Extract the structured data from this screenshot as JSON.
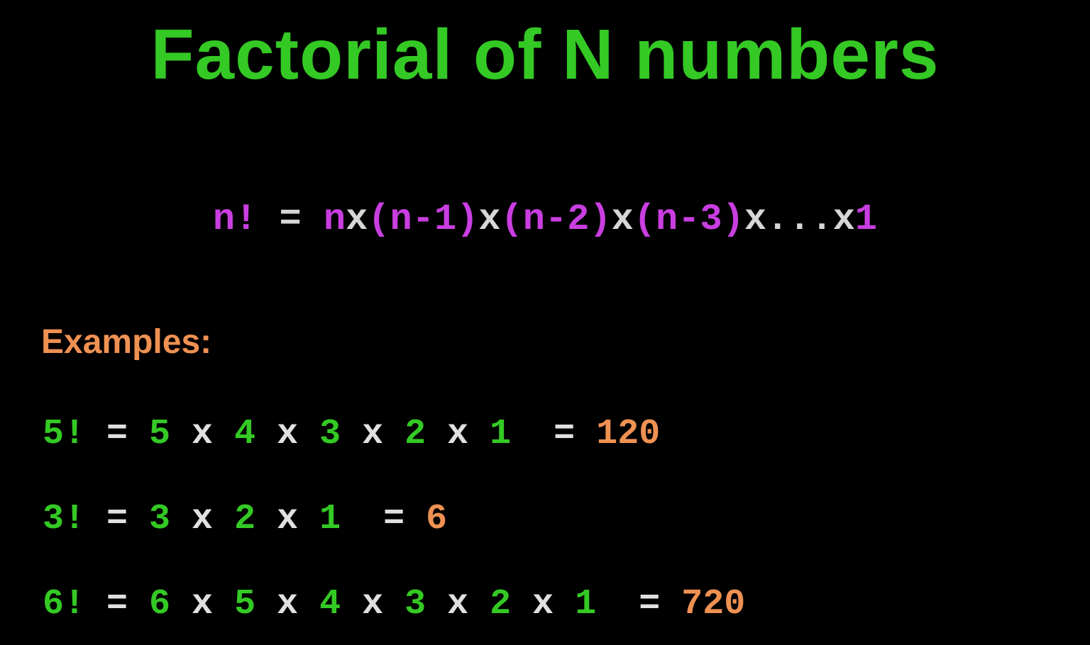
{
  "title": "Factorial of N numbers",
  "formula": {
    "tokens": [
      {
        "t": "n!",
        "c": "purple"
      },
      {
        "t": " = ",
        "c": "white"
      },
      {
        "t": "n",
        "c": "purple"
      },
      {
        "t": "x",
        "c": "white"
      },
      {
        "t": "(n-1)",
        "c": "purple"
      },
      {
        "t": "x",
        "c": "white"
      },
      {
        "t": "(n-2)",
        "c": "purple"
      },
      {
        "t": "x",
        "c": "white"
      },
      {
        "t": "(n-3)",
        "c": "purple"
      },
      {
        "t": "x...x",
        "c": "white"
      },
      {
        "t": "1",
        "c": "purple"
      }
    ]
  },
  "examples_label": "Examples:",
  "examples": [
    {
      "tokens": [
        {
          "t": "5!",
          "c": "green"
        },
        {
          "t": " = ",
          "c": "white"
        },
        {
          "t": "5",
          "c": "green"
        },
        {
          "t": " x ",
          "c": "white"
        },
        {
          "t": "4",
          "c": "green"
        },
        {
          "t": " x ",
          "c": "white"
        },
        {
          "t": "3",
          "c": "green"
        },
        {
          "t": " x ",
          "c": "white"
        },
        {
          "t": "2",
          "c": "green"
        },
        {
          "t": " x ",
          "c": "white"
        },
        {
          "t": "1",
          "c": "green"
        },
        {
          "t": "  = ",
          "c": "white"
        },
        {
          "t": "120",
          "c": "orange"
        }
      ]
    },
    {
      "tokens": [
        {
          "t": "3!",
          "c": "green"
        },
        {
          "t": " = ",
          "c": "white"
        },
        {
          "t": "3",
          "c": "green"
        },
        {
          "t": " x ",
          "c": "white"
        },
        {
          "t": "2",
          "c": "green"
        },
        {
          "t": " x ",
          "c": "white"
        },
        {
          "t": "1",
          "c": "green"
        },
        {
          "t": "  = ",
          "c": "white"
        },
        {
          "t": "6",
          "c": "orange"
        }
      ]
    },
    {
      "tokens": [
        {
          "t": "6!",
          "c": "green"
        },
        {
          "t": " = ",
          "c": "white"
        },
        {
          "t": "6",
          "c": "green"
        },
        {
          "t": " x ",
          "c": "white"
        },
        {
          "t": "5",
          "c": "green"
        },
        {
          "t": " x ",
          "c": "white"
        },
        {
          "t": "4",
          "c": "green"
        },
        {
          "t": " x ",
          "c": "white"
        },
        {
          "t": "3",
          "c": "green"
        },
        {
          "t": " x ",
          "c": "white"
        },
        {
          "t": "2",
          "c": "green"
        },
        {
          "t": " x ",
          "c": "white"
        },
        {
          "t": "1",
          "c": "green"
        },
        {
          "t": "  = ",
          "c": "white"
        },
        {
          "t": "720",
          "c": "orange"
        }
      ]
    }
  ]
}
